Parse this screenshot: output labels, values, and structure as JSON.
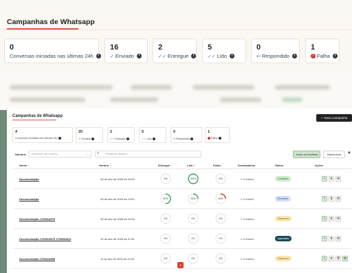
{
  "header": {
    "title": "Campanhas de Whatsapp"
  },
  "big_stats": [
    {
      "value": "0",
      "label": "Conversas iniciadas nas últimas 24h",
      "icon": "info-icon"
    },
    {
      "value": "16",
      "label": "Enviado",
      "icon": "check-icon"
    },
    {
      "value": "2",
      "label": "Entregue",
      "icon": "double-check-icon"
    },
    {
      "value": "5",
      "label": "Lido",
      "icon": "double-check-read-icon"
    },
    {
      "value": "0",
      "label": "Respondido",
      "icon": "reply-icon"
    },
    {
      "value": "1",
      "label": "Falha",
      "icon": "alert-icon"
    }
  ],
  "inner": {
    "title": "Campanhas de Whatsapp",
    "new_button": "Nova Campanha",
    "stats": [
      {
        "value": "4",
        "label": "Conversas iniciadas nas últimas 24h"
      },
      {
        "value": "20",
        "label": "Enviado"
      },
      {
        "value": "2",
        "label": "Entregue"
      },
      {
        "value": "5",
        "label": "Lido"
      },
      {
        "value": "0",
        "label": "Respondido"
      },
      {
        "value": "1",
        "label": "Falha"
      }
    ],
    "filters": {
      "number_label": "Número:",
      "number_placeholder": "Adicionar um número",
      "search_placeholder": "Pesquisar disparo",
      "all_models": "Todos os modelos",
      "drafts": "Rascunhos"
    },
    "columns": [
      "Nome",
      "Horário",
      "Entregue",
      "Lido",
      "Falha",
      "Destinatários",
      "Status",
      "Ações"
    ],
    "rows": [
      {
        "name": "Documentação",
        "time": "05 de dez de 2025 às 15:39",
        "entregue": "0%",
        "lido": "100%",
        "falha": "0%",
        "dest": "4 Contatos",
        "status": "Completo",
        "status_color": "#cfe9cf",
        "status_text": "#2e6b2e",
        "actions": 3,
        "entregue_pct": 0,
        "lido_pct": 100,
        "falha_pct": 0
      },
      {
        "name": "Documentação",
        "time": "05 de dez de 2025 às 13:00",
        "entregue": "50%",
        "lido": "25%",
        "falha": "25%",
        "dest": "4 Contatos",
        "status": "Enviando",
        "status_color": "#cfe0f7",
        "status_text": "#2c4f86",
        "actions": 3,
        "entregue_pct": 50,
        "lido_pct": 25,
        "falha_pct": 25
      },
      {
        "name": "Documentação 1765414575",
        "time": "05 de dez de 2025 às 15:38",
        "entregue": "0%",
        "lido": "0%",
        "falha": "0%",
        "dest": "4 Contatos",
        "status": "Rascunho",
        "status_color": "#fde6b3",
        "status_text": "#7a5a14",
        "actions": 3,
        "entregue_pct": 0,
        "lido_pct": 0,
        "falha_pct": 0
      },
      {
        "name": "Documentação 1765414575 1765350813",
        "time": "10 de dez de 2025 às 11:00",
        "entregue": "0%",
        "lido": "0%",
        "falha": "0%",
        "dest": "4 Contatos",
        "status": "Agendado",
        "status_color": "#1e4a5a",
        "status_text": "#ffffff",
        "actions": 3,
        "entregue_pct": 0,
        "lido_pct": 0,
        "falha_pct": 0
      },
      {
        "name": "Documentação 1765414558",
        "time": "11 de dez de 2025 às 12:00",
        "entregue": "0%",
        "lido": "0%",
        "falha": "0%",
        "dest": "4 Contatos",
        "status": "Rascunho",
        "status_color": "#fde6b3",
        "status_text": "#7a5a14",
        "actions": 4,
        "entregue_pct": 0,
        "lido_pct": 0,
        "falha_pct": 0
      }
    ],
    "page": "1"
  }
}
